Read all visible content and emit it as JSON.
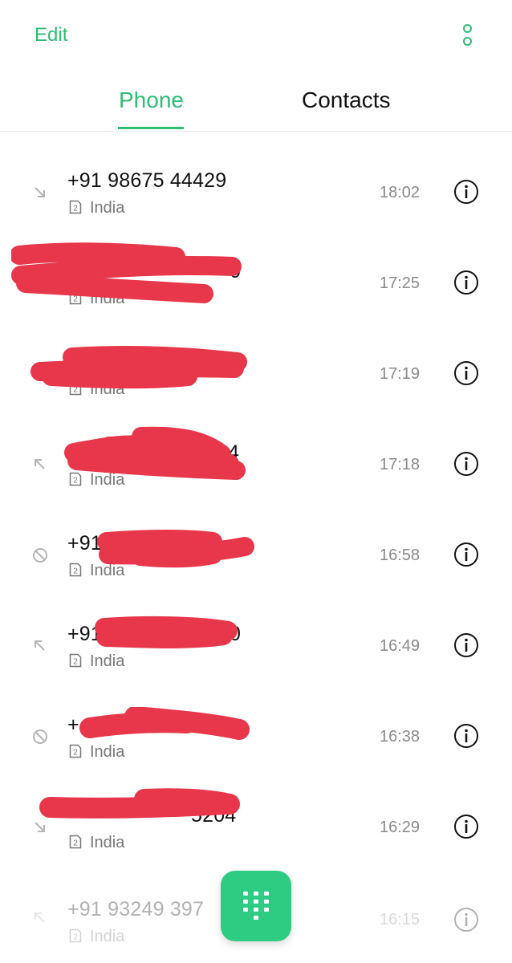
{
  "header": {
    "edit_label": "Edit",
    "menu_icon": "more-vertical-icon",
    "accent_color": "#2ebd75"
  },
  "tabs": [
    {
      "label": "Phone",
      "active": true
    },
    {
      "label": "Contacts",
      "active": false
    }
  ],
  "calls": [
    {
      "number": "+91 98675 44429",
      "sim": "2",
      "region": "India",
      "time": "18:02",
      "direction": "incoming"
    },
    {
      "number": "0",
      "sim": "2",
      "region": "India",
      "time": "17:25",
      "direction": "unknown",
      "redacted": true
    },
    {
      "number": "",
      "sim": "2",
      "region": "India",
      "time": "17:19",
      "direction": "unknown",
      "redacted": true
    },
    {
      "number": "4",
      "sim": "2",
      "region": "India",
      "time": "17:18",
      "direction": "outgoing",
      "redacted": true
    },
    {
      "number": "+91",
      "sim": "2",
      "region": "India",
      "time": "16:58",
      "direction": "blocked",
      "redacted": true
    },
    {
      "number": "+91",
      "sim": "2",
      "region": "India",
      "time": "16:49",
      "direction": "outgoing",
      "redacted": true
    },
    {
      "number": "+",
      "sim": "2",
      "region": "India",
      "time": "16:38",
      "direction": "blocked",
      "redacted": true
    },
    {
      "number": "5204",
      "sim": "2",
      "region": "India",
      "time": "16:29",
      "direction": "incoming",
      "redacted": true
    },
    {
      "number": "+91 93249 397",
      "sim": "2",
      "region": "India",
      "time": "16:15",
      "direction": "outgoing"
    }
  ],
  "fab": {
    "icon": "dialpad-icon"
  }
}
